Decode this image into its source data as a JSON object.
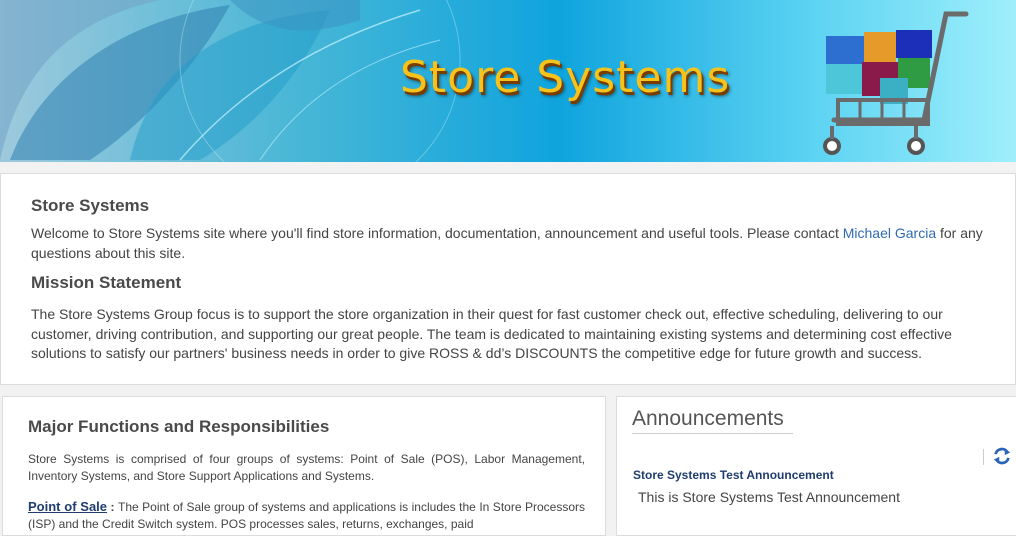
{
  "banner": {
    "title": "Store Systems"
  },
  "intro": {
    "heading": "Store Systems",
    "welcome_before": "Welcome to Store Systems site where you'll find store information, documentation, announcement and useful tools. Please contact ",
    "contact_name": "Michael Garcia",
    "welcome_after": " for any questions about this site.",
    "mission_heading": "Mission Statement",
    "mission_text": "The Store Systems Group focus is to support the store organization in their quest for fast customer check out, effective scheduling, delivering to our customer, driving contribution, and supporting our great people. The team is dedicated to maintaining existing systems and determining cost effective solutions to satisfy our partners' business needs in order to give ROSS & dd’s DISCOUNTS the competitive edge for future growth and success."
  },
  "functions": {
    "heading": "Major Functions and Responsibilities",
    "summary": "Store Systems is comprised of four groups of systems: Point of Sale (POS), Labor Management, Inventory Systems, and Store Support Applications and Systems.",
    "pos_link": "Point of Sale",
    "pos_separator": " : ",
    "pos_text": "The Point of Sale group of systems and applications is includes the In Store Processors (ISP) and the Credit Switch system. POS processes sales, returns, exchanges, paid"
  },
  "announcements": {
    "title": "Announcements",
    "refresh_icon": "refresh-icon",
    "item_title": "Store Systems Test Announcement",
    "item_body": "This is Store Systems Test Announcement"
  },
  "colors": {
    "link": "#2f6bb3",
    "heading_dark": "#1f3d6e",
    "banner_title": "#f7c21a"
  }
}
